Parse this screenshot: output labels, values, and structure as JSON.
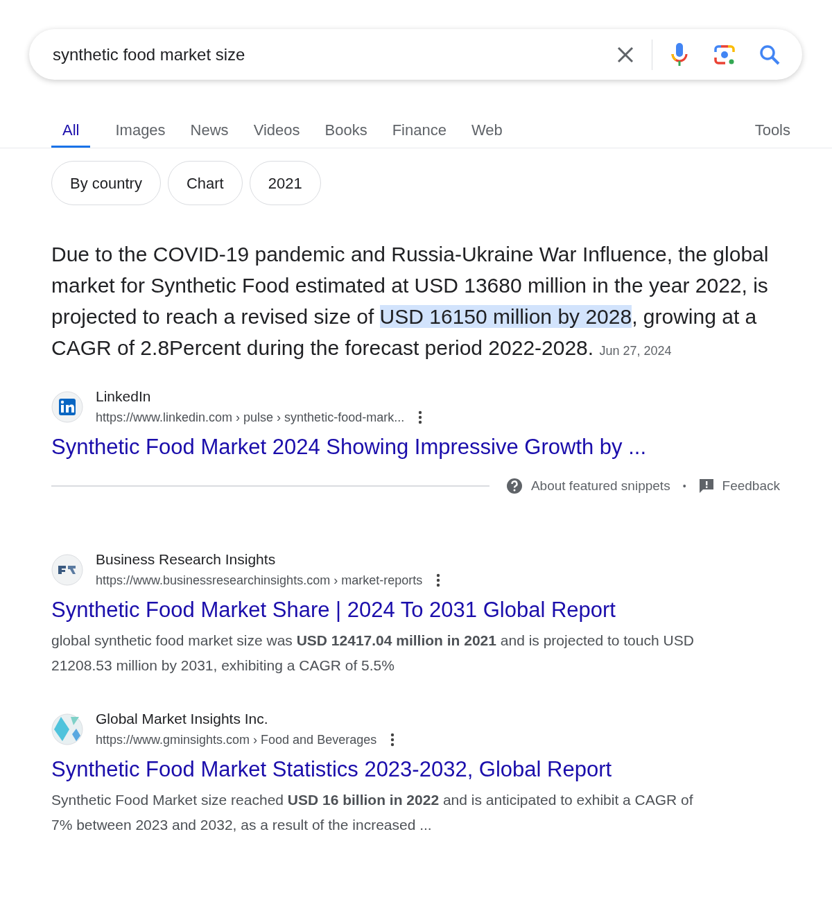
{
  "search": {
    "value": "synthetic food market size"
  },
  "tabs": [
    {
      "label": "All",
      "selected": true
    },
    {
      "label": "Images",
      "selected": false
    },
    {
      "label": "News",
      "selected": false
    },
    {
      "label": "Videos",
      "selected": false
    },
    {
      "label": "Books",
      "selected": false
    },
    {
      "label": "Finance",
      "selected": false
    },
    {
      "label": "Web",
      "selected": false
    }
  ],
  "tools": "Tools",
  "chips": [
    "By country",
    "Chart",
    "2021"
  ],
  "featured_snippet": {
    "text_before": "Due to the COVID-19 pandemic and Russia-Ukraine War Influence, the global market for Synthetic Food estimated at USD 13680 million in the year 2022, is projected to reach a revised size of ",
    "highlighted": "USD 16150 million by 2028",
    "text_after": ", growing at a CAGR of 2.8Percent during the forecast period 2022-2028.",
    "date": "Jun 27, 2024",
    "source": "LinkedIn",
    "url": "https://www.linkedin.com › pulse › synthetic-food-mark...",
    "title": "Synthetic Food Market 2024 Showing Impressive Growth by ...",
    "about": "About featured snippets",
    "separator": "•",
    "feedback": "Feedback"
  },
  "results": [
    {
      "kind": "bri",
      "source": "Business Research Insights",
      "url": "https://www.businessresearchinsights.com › market-reports",
      "title": "Synthetic Food Market Share | 2024 To 2031 Global Report",
      "snippet": "global synthetic food market size was **USD 12417.04 million in 2021** and is projected to touch USD 21208.53 million by 2031, exhibiting a CAGR of 5.5%"
    },
    {
      "kind": "gmi",
      "source": "Global Market Insights Inc.",
      "url": "https://www.gminsights.com › Food and Beverages",
      "title": "Synthetic Food Market Statistics 2023-2032, Global Report",
      "snippet": "Synthetic Food Market size reached **USD 16 billion in 2022** and is anticipated to exhibit a CAGR of 7% between 2023 and 2032, as a result of the increased ..."
    }
  ]
}
